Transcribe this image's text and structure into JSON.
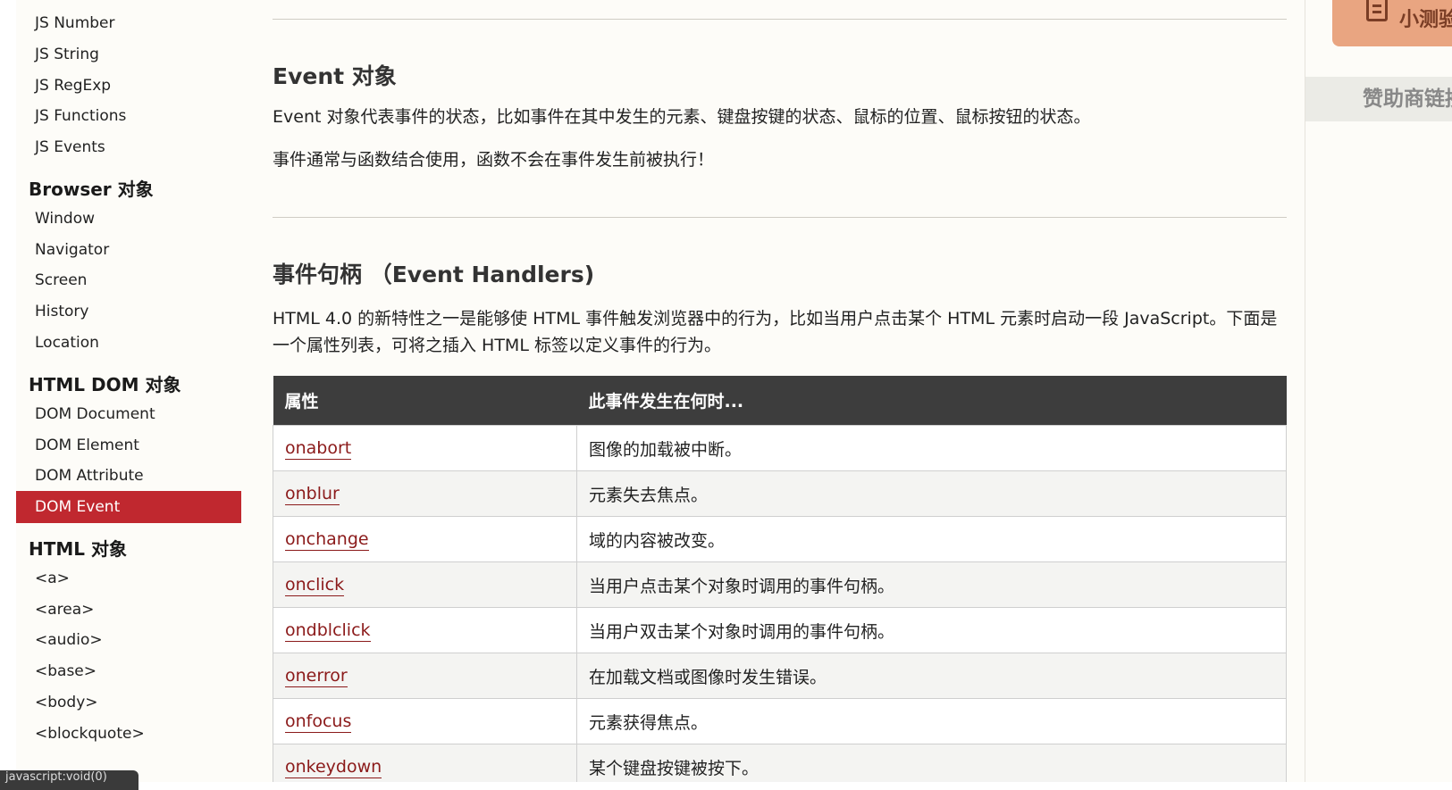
{
  "sidebar": {
    "js_items": [
      "JS Number",
      "JS String",
      "JS RegExp",
      "JS Functions",
      "JS Events"
    ],
    "browser_heading": "Browser 对象",
    "browser_items": [
      "Window",
      "Navigator",
      "Screen",
      "History",
      "Location"
    ],
    "htmldom_heading": "HTML DOM 对象",
    "htmldom_items": [
      "DOM Document",
      "DOM Element",
      "DOM Attribute",
      "DOM Event"
    ],
    "active_item": "DOM Event",
    "html_heading": "HTML 对象",
    "html_items": [
      "<a>",
      "<area>",
      "<audio>",
      "<base>",
      "<body>",
      "<blockquote>"
    ]
  },
  "main": {
    "event_title": "Event 对象",
    "event_desc1": "Event 对象代表事件的状态，比如事件在其中发生的元素、键盘按键的状态、鼠标的位置、鼠标按钮的状态。",
    "event_desc2": "事件通常与函数结合使用，函数不会在事件发生前被执行！",
    "handlers_title": "事件句柄 （Event Handlers)",
    "handlers_desc": "HTML 4.0 的新特性之一是能够使 HTML 事件触发浏览器中的行为，比如当用户点击某个 HTML 元素时启动一段 JavaScript。下面是一个属性列表，可将之插入 HTML 标签以定义事件的行为。",
    "table": {
      "headers": [
        "属性",
        "此事件发生在何时..."
      ],
      "rows": [
        {
          "attr": "onabort",
          "desc": "图像的加载被中断。"
        },
        {
          "attr": "onblur",
          "desc": "元素失去焦点。"
        },
        {
          "attr": "onchange",
          "desc": "域的内容被改变。"
        },
        {
          "attr": "onclick",
          "desc": "当用户点击某个对象时调用的事件句柄。"
        },
        {
          "attr": "ondblclick",
          "desc": "当用户双击某个对象时调用的事件句柄。"
        },
        {
          "attr": "onerror",
          "desc": "在加载文档或图像时发生错误。"
        },
        {
          "attr": "onfocus",
          "desc": "元素获得焦点。"
        },
        {
          "attr": "onkeydown",
          "desc": "某个键盘按键被按下。"
        }
      ]
    }
  },
  "right": {
    "quiz_label": "小测验",
    "sponsor_label": "赞助商链接"
  },
  "statusbar": {
    "text": "javascript:void(0)"
  }
}
